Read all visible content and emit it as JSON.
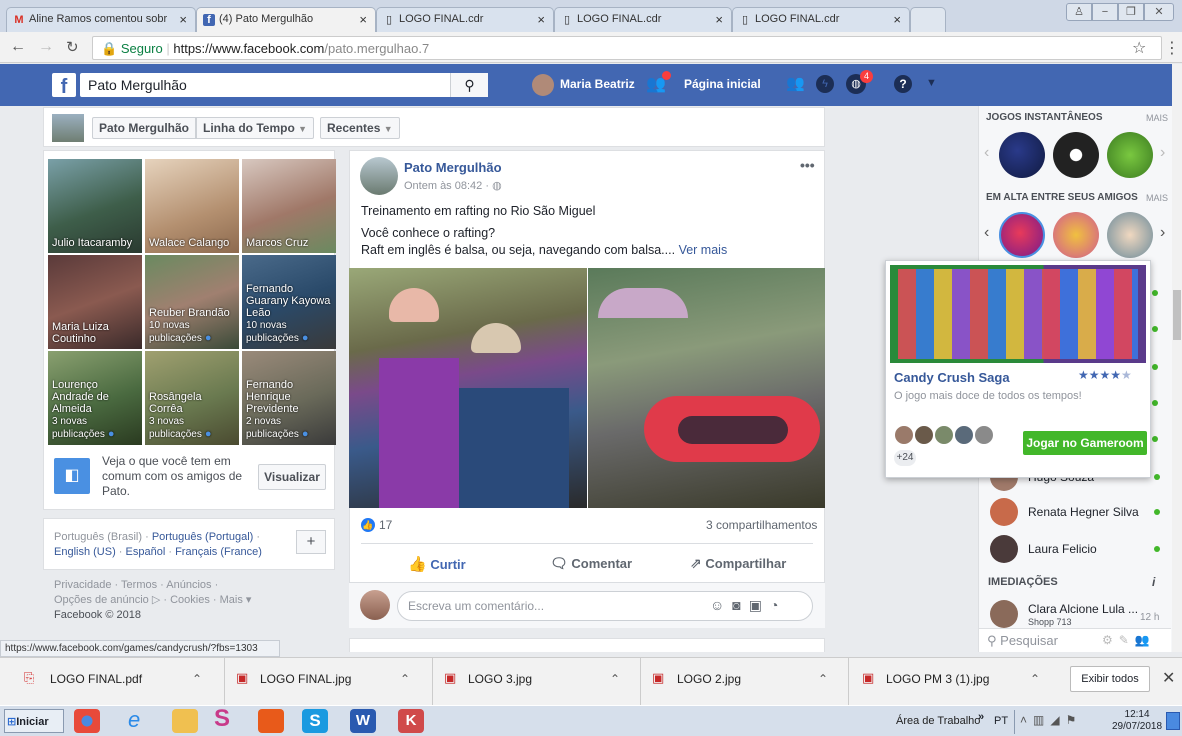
{
  "browser": {
    "tabs": [
      {
        "label": "Aline Ramos comentou sobr",
        "icon": "gmail-icon"
      },
      {
        "label": "(4) Pato Mergulhão",
        "icon": "facebook-icon"
      },
      {
        "label": "LOGO FINAL.cdr",
        "icon": "page-icon"
      },
      {
        "label": "LOGO FINAL.cdr",
        "icon": "page-icon"
      },
      {
        "label": "LOGO FINAL.cdr",
        "icon": "page-icon"
      }
    ],
    "secure_label": "Seguro",
    "url_host": "https://www.facebook.com",
    "url_path": "/pato.mergulhao.7"
  },
  "fbbar": {
    "search_value": "Pato Mergulhão",
    "user_name": "Maria Beatriz",
    "home_label": "Página inicial",
    "notif_count": "4"
  },
  "profile_nav": {
    "name": "Pato Mergulhão",
    "timeline": "Linha do Tempo",
    "recent": "Recentes"
  },
  "friends": [
    {
      "name": "Julio Itacaramby",
      "sub": ""
    },
    {
      "name": "Walace Calango",
      "sub": ""
    },
    {
      "name": "Marcos Cruz",
      "sub": ""
    },
    {
      "name": "Maria Luiza Coutinho",
      "sub": ""
    },
    {
      "name": "Reuber Brandão",
      "sub": "10 novas publicações"
    },
    {
      "name": "Fernando Guarany Kayowa Leão",
      "sub": "10 novas publicações"
    },
    {
      "name": "Lourenço Andrade de Almeida",
      "sub": "3 novas publicações"
    },
    {
      "name": "Rosângela Corrêa",
      "sub": "3 novas publicações"
    },
    {
      "name": "Fernando Henrique Previdente",
      "sub": "2 novas publicações"
    }
  ],
  "compare": {
    "text": "Veja o que você tem em comum com os amigos de Pato.",
    "button": "Visualizar"
  },
  "languages": {
    "current": "Português (Brasil)",
    "links": [
      "Português (Portugal)",
      "English (US)",
      "Español",
      "Français (France)"
    ],
    "add": "+"
  },
  "footer": {
    "line1": "Privacidade · Termos · Anúncios ·",
    "line2": "Opções de anúncio ▷ · Cookies · Mais ▾",
    "copyright": "Facebook © 2018"
  },
  "post": {
    "author": "Pato Mergulhão",
    "time": "Ontem às 08:42 ·",
    "text1": "Treinamento em rafting no Rio São Miguel",
    "text2": "Você conhece o rafting?",
    "text3": "Raft em inglês é balsa, ou seja, navegando com balsa....",
    "see_more": "Ver mais",
    "reactions": "17",
    "shares": "3 compartilhamentos",
    "like": "Curtir",
    "comment": "Comentar",
    "share": "Compartilhar",
    "comment_placeholder": "Escreva um comentário..."
  },
  "rightcol": {
    "instant_games": "JOGOS INSTANTÂNEOS",
    "mais": "MAIS",
    "trending": "EM ALTA ENTRE SEUS AMIGOS",
    "chats": [
      {
        "name": "Hugo Souza"
      },
      {
        "name": "Renata Hegner Silva"
      },
      {
        "name": "Laura Felicio"
      }
    ],
    "nearby": "IMEDIAÇÕES",
    "nearby_item": "Clara Alcione Lula ...",
    "nearby_sub": "Shopp 713",
    "nearby_time": "12 h",
    "search_placeholder": "Pesquisar"
  },
  "candy": {
    "title": "Candy Crush Saga",
    "rating": 4.5,
    "subtitle": "O jogo mais doce de todos os tempos!",
    "extra": "+24",
    "play": "Jogar no Gameroom"
  },
  "status_url": "https://www.facebook.com/games/candycrush/?fbs=1303",
  "downloads": {
    "items": [
      "LOGO FINAL.pdf",
      "LOGO FINAL.jpg",
      "LOGO 3.jpg",
      "LOGO 2.jpg",
      "LOGO PM 3 (1).jpg"
    ],
    "show_all": "Exibir todos"
  },
  "taskbar": {
    "start": "Iniciar",
    "desktop": "Área de Trabalho",
    "lang": "PT",
    "time": "12:14",
    "date": "29/07/2018"
  }
}
